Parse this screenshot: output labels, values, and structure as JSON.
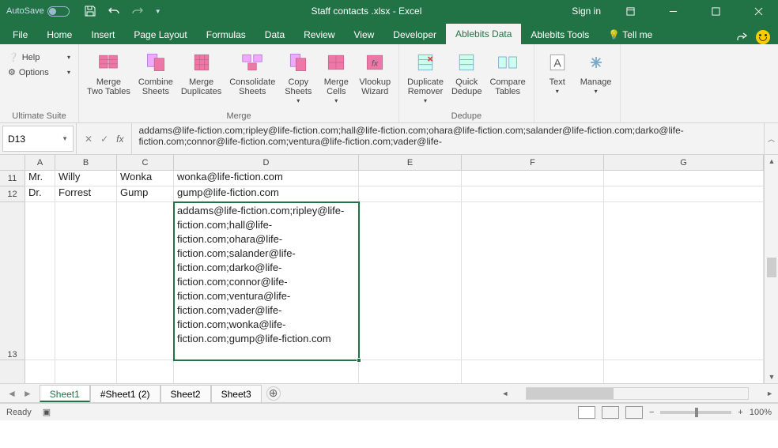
{
  "title_bar": {
    "autosave": "AutoSave",
    "filename": "Staff contacts .xlsx  -  Excel",
    "signin": "Sign in"
  },
  "tabs": {
    "file": "File",
    "home": "Home",
    "insert": "Insert",
    "pagelayout": "Page Layout",
    "formulas": "Formulas",
    "data": "Data",
    "review": "Review",
    "view": "View",
    "developer": "Developer",
    "abdata": "Ablebits Data",
    "abtools": "Ablebits Tools",
    "tellme": "Tell me"
  },
  "ribbon": {
    "help": "Help",
    "options": "Options",
    "ultimate": "Ultimate Suite",
    "merge_two": "Merge\nTwo Tables",
    "combine": "Combine\nSheets",
    "merge_dup": "Merge\nDuplicates",
    "consolidate": "Consolidate\nSheets",
    "copy": "Copy\nSheets",
    "merge_cells": "Merge\nCells",
    "vlookup": "Vlookup\nWizard",
    "merge_lbl": "Merge",
    "dup_rem": "Duplicate\nRemover",
    "quick": "Quick\nDedupe",
    "compare": "Compare\nTables",
    "dedupe_lbl": "Dedupe",
    "text": "Text",
    "manage": "Manage"
  },
  "name_box": "D13",
  "formula": "addams@life-fiction.com;ripley@life-fiction.com;hall@life-fiction.com;ohara@life-fiction.com;salander@life-fiction.com;darko@life-fiction.com;connor@life-fiction.com;ventura@life-fiction.com;vader@life-",
  "cols": {
    "a": "A",
    "b": "B",
    "c": "C",
    "d": "D",
    "e": "E",
    "f": "F",
    "g": "G"
  },
  "rows": {
    "r11": {
      "n": "11",
      "a": "Mr.",
      "b": "Willy",
      "c": "Wonka",
      "d": "wonka@life-fiction.com"
    },
    "r12": {
      "n": "12",
      "a": "Dr.",
      "b": "Forrest",
      "c": "Gump",
      "d": "gump@life-fiction.com"
    },
    "r13": {
      "n": "13",
      "d": "addams@life-fiction.com;ripley@life-fiction.com;hall@life-fiction.com;ohara@life-fiction.com;salander@life-fiction.com;darko@life-fiction.com;connor@life-fiction.com;ventura@life-fiction.com;vader@life-fiction.com;wonka@life-fiction.com;gump@life-fiction.com"
    }
  },
  "sheets": {
    "s1": "Sheet1",
    "s1b": "#Sheet1 (2)",
    "s2": "Sheet2",
    "s3": "Sheet3"
  },
  "status": {
    "ready": "Ready",
    "zoom": "100%"
  }
}
